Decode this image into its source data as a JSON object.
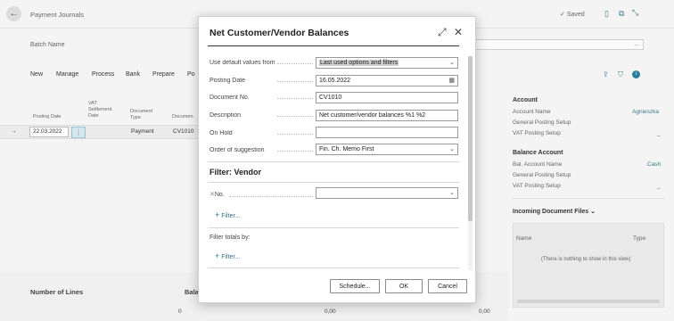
{
  "page": {
    "title": "Payment Journals",
    "saved": "Saved",
    "batch_name_label": "Batch Name",
    "batch_dropdown": "...",
    "actions": [
      "New",
      "Manage",
      "Process",
      "Bank",
      "Prepare",
      "Po"
    ],
    "columns": [
      "Posting Date",
      "VAT Settlement Date",
      "Document Type",
      "Documen"
    ],
    "row": {
      "posting_date": "22.03.2022",
      "document_type": "Payment",
      "document_no": "CV1010"
    },
    "right_panel": {
      "account_header": "Account",
      "account_name_label": "Account Name",
      "account_name_value": "Agnieszka",
      "gen_posting_setup_label": "General Posting Setup",
      "vat_posting_setup_label": "VAT Posting Setup",
      "vat_value": "_",
      "balance_header": "Balance Account",
      "bal_account_name_label": "Bal. Account Name",
      "bal_account_name_value": "Cash",
      "bal_gen_posting_label": "General Posting Setup",
      "bal_vat_posting_label": "VAT Posting Setup",
      "bal_vat_value": "_",
      "incoming_header": "Incoming Document Files",
      "inc_col_name": "Name",
      "inc_col_type": "Type",
      "inc_empty": "(There is nothing to show in this view)"
    },
    "bottom": {
      "number_of_lines": "Number of Lines",
      "bal_label": "Bala",
      "v0": "0",
      "v1": "0,00",
      "v2": "0,00"
    }
  },
  "dialog": {
    "title": "Net Customer/Vendor Balances",
    "fields": [
      {
        "label": "Use default values from",
        "value": "Last used options and filters",
        "type": "select"
      },
      {
        "label": "Posting Date",
        "value": "16.05.2022",
        "type": "date"
      },
      {
        "label": "Document No.",
        "value": "CV1010",
        "type": "text"
      },
      {
        "label": "Description",
        "value": "Net customer/vendor balances %1 %2",
        "type": "text"
      },
      {
        "label": "On Hold",
        "value": "",
        "type": "text"
      },
      {
        "label": "Order of suggestion",
        "value": "Fin. Ch. Memo First",
        "type": "select"
      }
    ],
    "filter_vendor_title": "Filter: Vendor",
    "filter_no_label": "No.",
    "filter_link": "Filter...",
    "filter_totals_label": "Filter totals by:",
    "filter_totals_link": "Filter...",
    "buttons": {
      "schedule": "Schedule...",
      "ok": "OK",
      "cancel": "Cancel"
    }
  }
}
